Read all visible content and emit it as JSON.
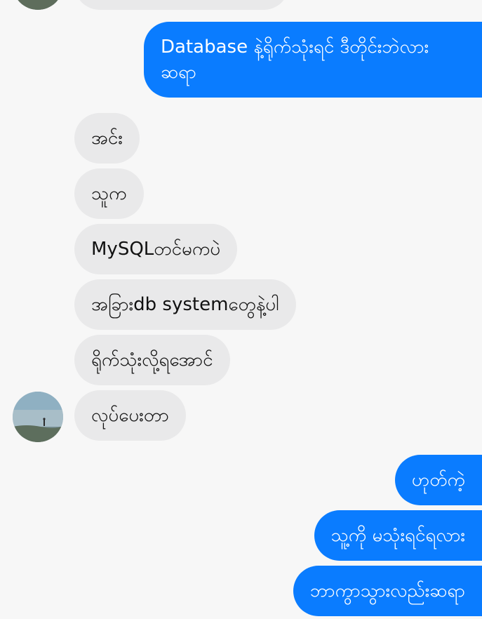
{
  "conversation": {
    "messages": [
      {
        "direction": "out",
        "text": "Database နဲ့ရိုက်သုံးရင် ဒီတိုင်းဘဲလား ဆရာ"
      },
      {
        "direction": "in",
        "text": "အင်း"
      },
      {
        "direction": "in",
        "text": "သူက"
      },
      {
        "direction": "in",
        "text": "MySQLတင်မကပဲ"
      },
      {
        "direction": "in",
        "text": "အခြားdb systemတွေနဲ့ပါ"
      },
      {
        "direction": "in",
        "text": "ရိုက်သုံးလို့ရအောင်"
      },
      {
        "direction": "in",
        "text": "လုပ်ပေးတာ"
      },
      {
        "direction": "out",
        "text": "ဟုတ်ကဲ့"
      },
      {
        "direction": "out",
        "text": "သူ့ကို မသုံးရင်ရလား"
      },
      {
        "direction": "out",
        "text": "ဘာကွာသွားလည်းဆရာ"
      }
    ]
  },
  "theme": {
    "outgoing_color": "#0a7cff",
    "incoming_color": "#e9e9ea",
    "background": "#f7f7f7"
  }
}
